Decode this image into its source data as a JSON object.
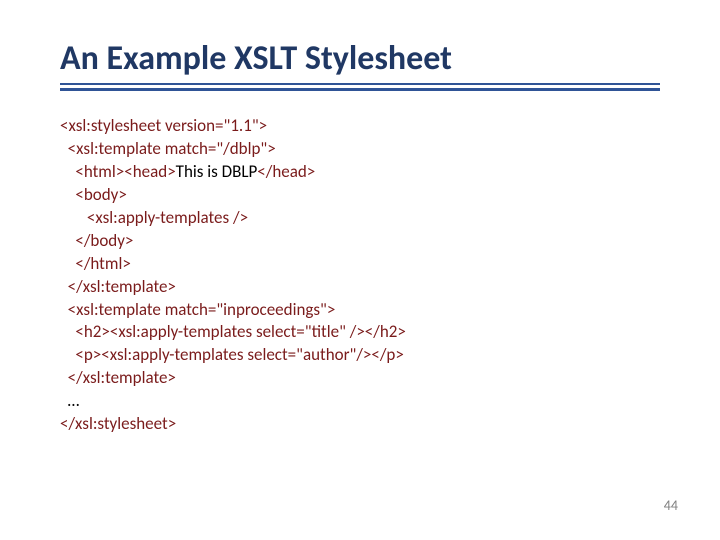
{
  "title": "An Example XSLT Stylesheet",
  "code": {
    "l1a": "<xsl:stylesheet version=\"1.1\">",
    "l2a": "  <xsl:template match=\"/dblp\">",
    "l3a": "    <html><head>",
    "l3b": "This is DBLP",
    "l3c": "</head>",
    "l4a": "    <body>",
    "l5a": "       <xsl:apply-templates />",
    "l6a": "    </body>",
    "l7a": "    </html>",
    "l8a": "  </xsl:template>",
    "l9a": "  <xsl:template match=\"inproceedings\">",
    "l10a": "    <h2><xsl:apply-templates select=\"title\" /></h2>",
    "l11a": "    <p><xsl:apply-templates select=\"author\"/></p>",
    "l12a": "  </xsl:template>",
    "l13a": "  …",
    "l14a": "</xsl:stylesheet>"
  },
  "pagenum": "44"
}
